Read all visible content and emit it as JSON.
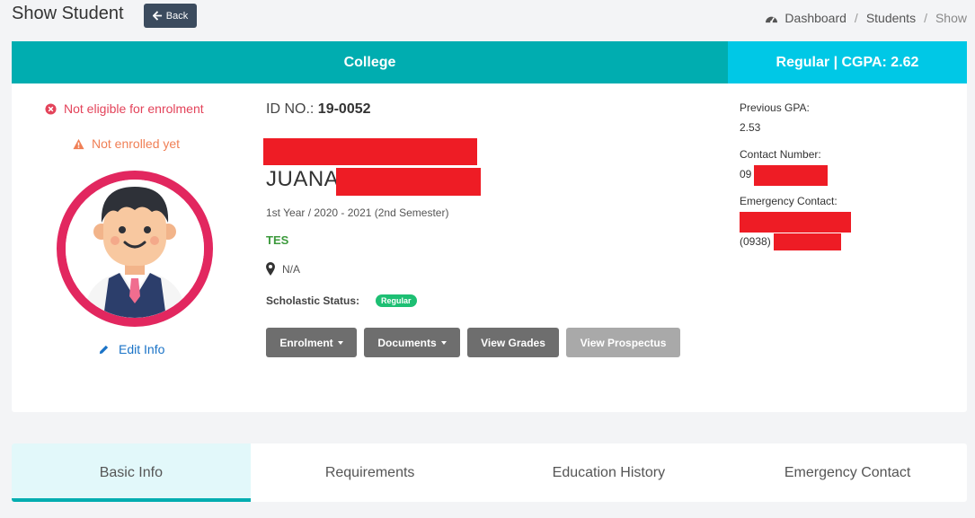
{
  "header": {
    "title": "Show Student",
    "back_label": "Back",
    "breadcrumb": [
      "Dashboard",
      "Students",
      "Show"
    ],
    "separator": "/"
  },
  "banner": {
    "department": "College",
    "status": "Regular | CGPA: 2.62",
    "colors": {
      "department_bg": "#00adb0",
      "status_bg": "#00c8e6"
    }
  },
  "notices": {
    "eligibility": "Not eligible for enrolment",
    "enrollment": "Not enrolled yet"
  },
  "profile": {
    "edit_label": "Edit Info",
    "avatar_icon": "student-avatar-icon"
  },
  "student": {
    "id_label": "ID NO.:",
    "id_value": "19-0052",
    "name": "JUANA",
    "year_semester": "1st Year / 2020 - 2021 (2nd Semester)",
    "program_tag": "TES",
    "address": "N/A",
    "scholastic_label": "Scholastic Status:",
    "scholastic_value": "Regular"
  },
  "actions": {
    "enrolment": "Enrolment",
    "documents": "Documents",
    "view_grades": "View Grades",
    "view_prospectus": "View Prospectus"
  },
  "details": {
    "previous_gpa_label": "Previous GPA:",
    "previous_gpa_value": "2.53",
    "contact_label": "Contact Number:",
    "contact_prefix": "09",
    "emergency_label": "Emergency Contact:",
    "emergency_prefix": "(0938)"
  },
  "tabs": [
    "Basic Info",
    "Requirements",
    "Education History",
    "Emergency Contact"
  ]
}
